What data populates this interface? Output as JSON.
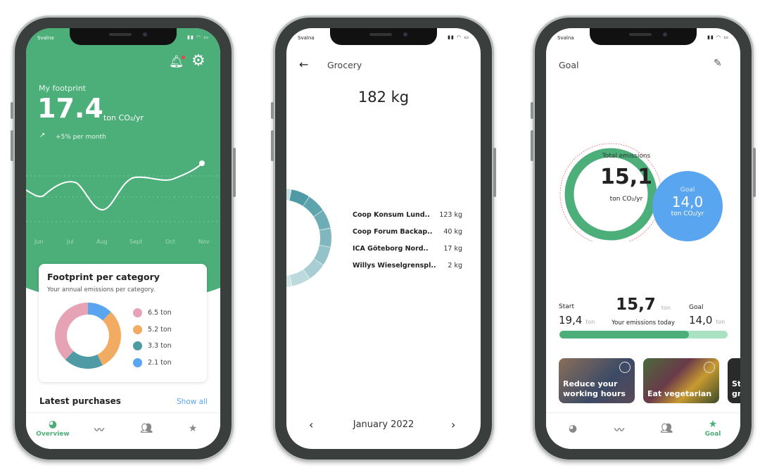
{
  "status_carrier": "Svalna",
  "overview": {
    "label": "My footprint",
    "value": "17.4",
    "unit": "ton CO₂/yr",
    "trend": "+5% per month",
    "months": [
      "Jun",
      "Jul",
      "Aug",
      "Sept",
      "Oct",
      "Nov"
    ],
    "card": {
      "title": "Footprint per category",
      "subtitle": "Your annual emissions per category.",
      "categories": [
        {
          "value": 2.1,
          "label": "2.1 ton",
          "color": "#5aa5f0",
          "icon": "car-icon"
        },
        {
          "value": 5.2,
          "label": "5.2 ton",
          "color": "#f2ab62",
          "icon": "home-icon"
        },
        {
          "value": 3.3,
          "label": "3.3 ton",
          "color": "#4f9ba5",
          "icon": "food-icon"
        },
        {
          "value": 6.5,
          "label": "6.5 ton",
          "color": "#e6a3b5",
          "icon": "shopping-icon"
        }
      ],
      "legend_order": [
        3,
        1,
        2,
        0
      ]
    },
    "latest": "Latest purchases",
    "show_all": "Show all",
    "nav": {
      "overview": "Overview"
    }
  },
  "grocery": {
    "title": "Grocery",
    "total": "182 kg",
    "rows": [
      {
        "name": "Coop Konsum Lund..",
        "value": "123 kg"
      },
      {
        "name": "Coop Forum Backap..",
        "value": "40 kg"
      },
      {
        "name": "ICA Göteborg Nord..",
        "value": "17 kg"
      },
      {
        "name": "Willys Wieselgrenspl..",
        "value": "2 kg"
      }
    ],
    "month": "January 2022"
  },
  "goal": {
    "title": "Goal",
    "total_label": "Total emissions",
    "total": "15,1",
    "unit": "ton CO₂/yr",
    "goal_label": "Goal",
    "goal_value": "14,0",
    "goal_unit": "ton CO₂/yr",
    "start_label": "Start",
    "start_value": "19,4",
    "ton": "ton",
    "today_value": "15,7",
    "today_label": "Your emissions today",
    "goal_small_label": "Goal",
    "goal_small_value": "14,0",
    "progress": 0.77,
    "cards": [
      {
        "label": "Reduce your working hours"
      },
      {
        "label": "Eat vegetarian"
      },
      {
        "label": "St gr"
      }
    ],
    "nav_label": "Goal"
  },
  "colors": {
    "green": "#4caf7a",
    "blue": "#5aa5f0",
    "teal": "#4f9ba5"
  }
}
